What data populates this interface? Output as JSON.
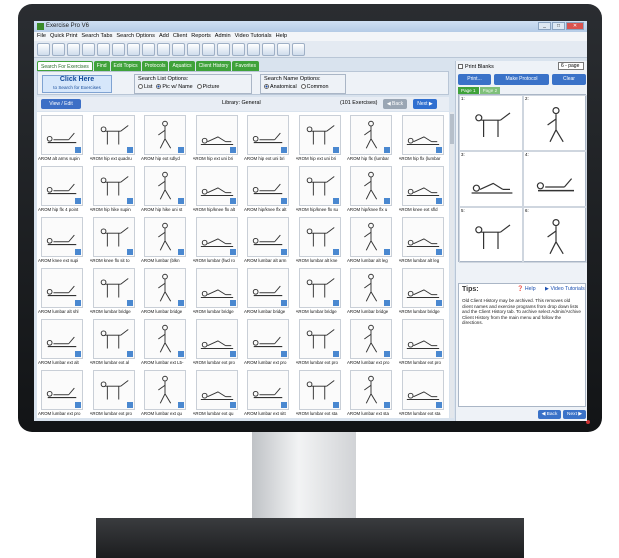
{
  "window": {
    "title": "Exercise Pro V6",
    "minimize": "_",
    "maximize": "□",
    "close": "✕"
  },
  "menu": [
    "File",
    "Quick Print",
    "Search Tabs",
    "Search Options",
    "Add",
    "Client",
    "Reports",
    "Admin",
    "Video Tutorials",
    "Help"
  ],
  "toolbar_icons": [
    "home-icon",
    "new-icon",
    "open-icon",
    "save-icon",
    "print-icon",
    "email-icon",
    "copy-icon",
    "paste-icon",
    "notes-icon",
    "chart-icon",
    "calendar-icon",
    "table-icon",
    "users-icon",
    "settings-icon",
    "flag-icon",
    "help-icon",
    "check-icon",
    "alert-icon"
  ],
  "tabs": [
    "Search For Exercises",
    "Find",
    "Edit Topics",
    "Protocols",
    "Aquatics",
    "Client History",
    "Favorites"
  ],
  "search": {
    "click_here": "Click Here",
    "click_sub": "to Search for Exercises",
    "list_options_title": "Search List Options:",
    "list_options": [
      "List",
      "Pic w/ Name",
      "Picture"
    ],
    "list_selected": 1,
    "name_options_title": "Search Name Options:",
    "name_options": [
      "Anatomical",
      "Common"
    ],
    "name_selected": 0
  },
  "library": {
    "view_label": "View / Edit",
    "title": "Library: General",
    "count": "(101 Exercises)",
    "back": "◀ Back",
    "next": "Next ▶"
  },
  "exercises": [
    "AROM alt arms supin",
    "AROM hip ext quadru",
    "AROM hip ext sdlyd",
    "AROM hip ext uni bri",
    "AROM hip ext uni bri",
    "AROM hip ext uni bri",
    "AROM hip flx (lumbar",
    "AROM hip flx (lumbar",
    "AROM hip flx 4 point",
    "AROM hip hike supin",
    "AROM hip hike uni st",
    "AROM hip/knee flx alt",
    "AROM hip/knee flx alt",
    "AROM hip/knee flx su",
    "AROM hip/knee flx u",
    "AROM knee ext sfld",
    "AROM knee ext supi",
    "AROM knee flx sit to",
    "AROM lumbar (blkn",
    "AROM lumbar (fwd ro",
    "AROM lumbar alt arm",
    "AROM lumbar alt kne",
    "AROM lumbar alt leg",
    "AROM lumbar alt leg",
    "AROM lumbar alt shl",
    "AROM lumbar bridge",
    "AROM lumbar bridge",
    "AROM lumbar bridge",
    "AROM lumbar bridge",
    "AROM lumbar bridge",
    "AROM lumbar bridge",
    "AROM lumbar bridge",
    "AROM lumbar ext alt",
    "AROM lumbar ext al",
    "AROM lumbar ext L5-",
    "AROM lumbar ext pro",
    "AROM lumbar ext pro",
    "AROM lumbar ext pro",
    "AROM lumbar ext pro",
    "AROM lumbar ext pro",
    "AROM lumbar ext pro",
    "AROM lumbar ext pro",
    "AROM lumbar ext qu",
    "AROM lumbar ext qu",
    "AROM lumbar ext sitt",
    "AROM lumbar ext sta",
    "AROM lumbar ext sta",
    "AROM lumbar ext sta"
  ],
  "right_panel": {
    "print_blanks": "Print Blanks",
    "page_select": "6 - page",
    "print": "Print...",
    "make_protocol": "Make Protocol",
    "clear": "Clear",
    "page_tabs": [
      "Page 1",
      "Page 2"
    ],
    "slot_numbers": [
      "1:",
      "2:",
      "3:",
      "4:",
      "5:",
      "6:"
    ],
    "tips_title": "Tips:",
    "help": "Help",
    "video_tutorials": "Video Tutorials",
    "tips_text": "Old Client History may be archived. This removes old client names and exercise programs from drop down lists and the Client History tab. To archive select Admin/Archive Client History from the main menu and follow the directions.",
    "back": "◀ Back",
    "next": "Next ▶"
  },
  "colors": {
    "accent_green": "#3fa23a",
    "accent_blue": "#3a72c8",
    "monitor": "#1c1e20"
  }
}
